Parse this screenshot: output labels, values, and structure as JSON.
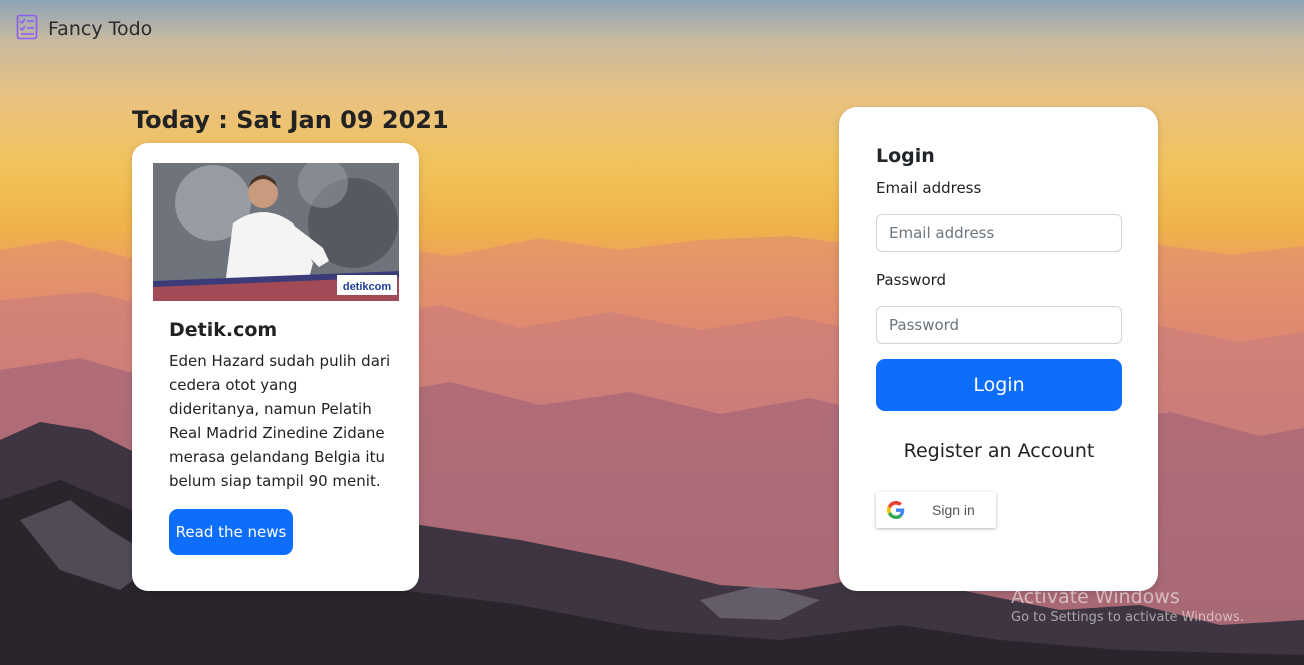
{
  "app": {
    "brand_title": "Fancy Todo",
    "brand_icon": "checklist-icon"
  },
  "today": {
    "label": "Today : Sat Jan 09 2021"
  },
  "news": {
    "image_caption": "detikcom",
    "source": "Detik.com",
    "text": "Eden Hazard sudah pulih dari cedera otot yang dideritanya, namun Pelatih Real Madrid Zinedine Zidane merasa gelandang Belgia itu belum siap tampil 90 menit.",
    "button_label": "Read the news"
  },
  "login": {
    "title": "Login",
    "email_label": "Email address",
    "email_placeholder": "Email address",
    "email_value": "",
    "password_label": "Password",
    "password_placeholder": "Password",
    "password_value": "",
    "button_label": "Login",
    "register_label": "Register an Account",
    "google_label": "Sign in"
  },
  "watermark": {
    "title": "Activate Windows",
    "subtitle": "Go to Settings to activate Windows."
  },
  "colors": {
    "primary": "#0d6efd",
    "card_bg": "#ffffff"
  }
}
